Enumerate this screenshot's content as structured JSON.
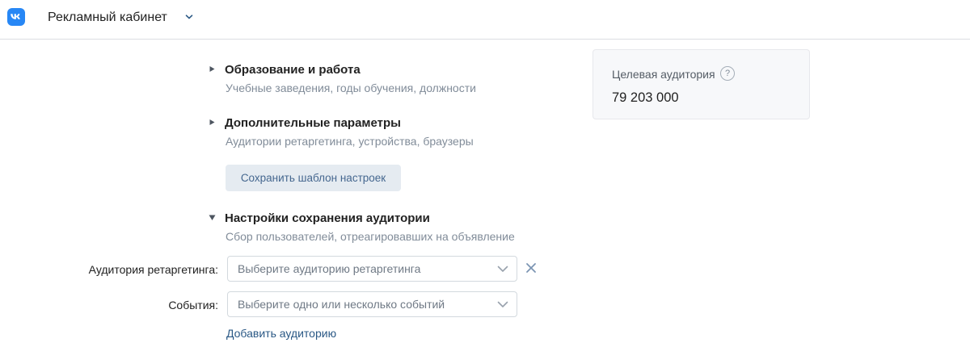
{
  "header": {
    "app_title": "Рекламный кабинет"
  },
  "sections": [
    {
      "title": "Образование и работа",
      "subtitle": "Учебные заведения, годы обучения, должности",
      "expanded": false
    },
    {
      "title": "Дополнительные параметры",
      "subtitle": "Аудитории ретаргетинга, устройства, браузеры",
      "expanded": false
    },
    {
      "title": "Настройки сохранения аудитории",
      "subtitle": "Сбор пользователей, отреагировавших на объявление",
      "expanded": true
    }
  ],
  "save_template_label": "Сохранить шаблон настроек",
  "audience_settings": {
    "retargeting": {
      "label": "Аудитория ретаргетинга:",
      "placeholder": "Выберите аудиторию ретаргетинга"
    },
    "events": {
      "label": "События:",
      "placeholder": "Выберите одно или несколько событий"
    },
    "add_audience_label": "Добавить аудиторию"
  },
  "target_audience": {
    "label": "Целевая аудитория",
    "help_glyph": "?",
    "value": "79 203 000"
  },
  "colors": {
    "accent": "#2787f5",
    "link": "#2a5885",
    "button_bg": "#e5ebf1",
    "button_text": "#45678f",
    "muted_text": "#818c99"
  },
  "icons": {
    "logo": "vk-logo-icon",
    "title_dropdown": "chevron-down-icon",
    "collapsed_arrow": "triangle-right-icon",
    "expanded_arrow": "triangle-down-icon",
    "select_dropdown": "chevron-down-icon",
    "clear": "close-icon",
    "help": "question-circle-icon"
  }
}
